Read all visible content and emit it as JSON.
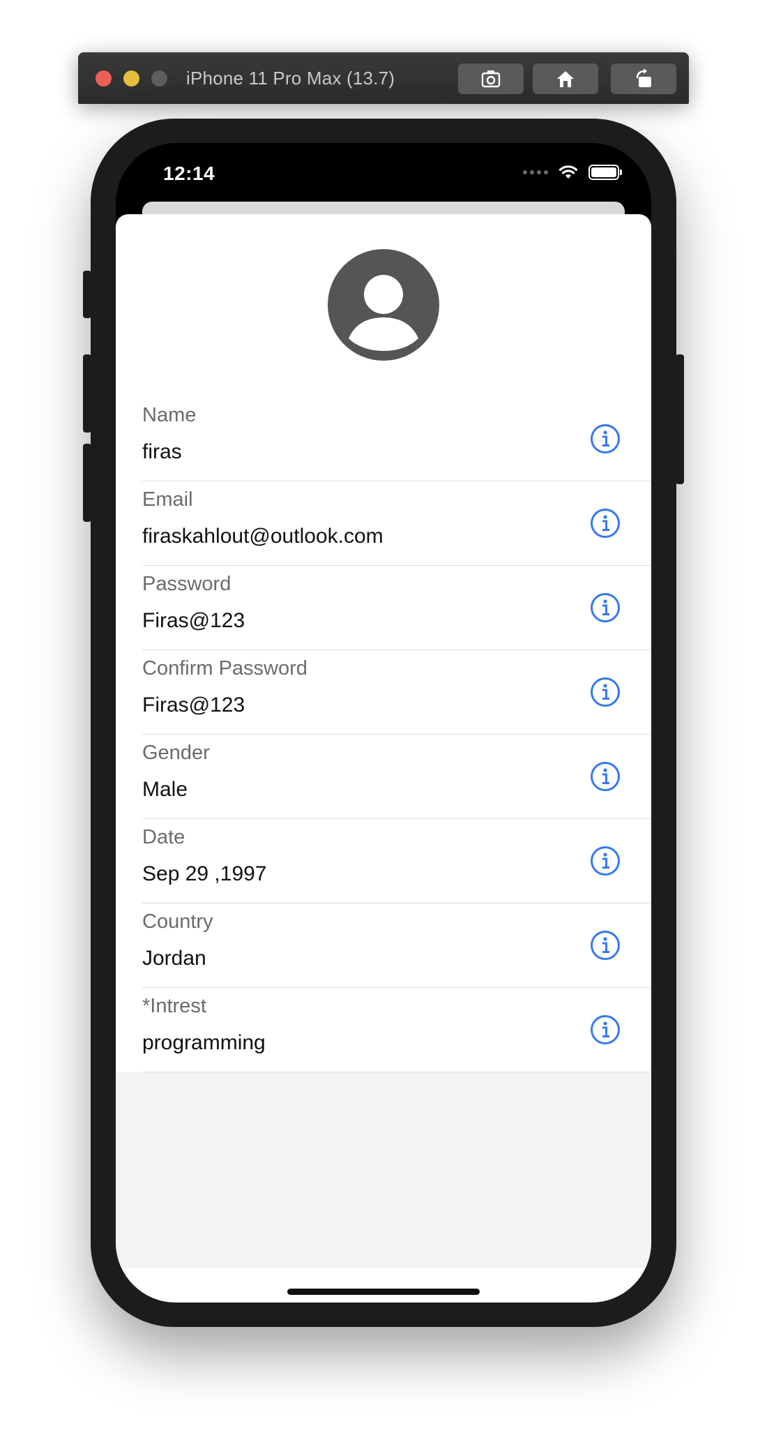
{
  "simulator": {
    "title": "iPhone 11 Pro Max (13.7)",
    "buttons": [
      {
        "icon": "screenshot-icon"
      },
      {
        "icon": "home-icon"
      },
      {
        "icon": "rotate-icon"
      }
    ]
  },
  "status_bar": {
    "time": "12:14",
    "signal_icon": "signal-dots-icon",
    "wifi_icon": "wifi-icon",
    "battery_icon": "battery-icon"
  },
  "profile": {
    "avatar_icon": "person-avatar-icon"
  },
  "form": {
    "fields": [
      {
        "label": "Name",
        "value": "firas"
      },
      {
        "label": "Email",
        "value": "firaskahlout@outlook.com"
      },
      {
        "label": "Password",
        "value": "Firas@123"
      },
      {
        "label": "Confirm Password",
        "value": "Firas@123"
      },
      {
        "label": "Gender",
        "value": "Male"
      },
      {
        "label": "Date",
        "value": "Sep 29 ,1997"
      },
      {
        "label": "Country",
        "value": "Jordan"
      },
      {
        "label": "*Intrest",
        "value": "programming"
      }
    ],
    "info_icon": "info-circle-icon"
  },
  "colors": {
    "accent": "#3478f6",
    "label": "#6b6b6b",
    "value": "#111111",
    "avatar": "#555555"
  }
}
